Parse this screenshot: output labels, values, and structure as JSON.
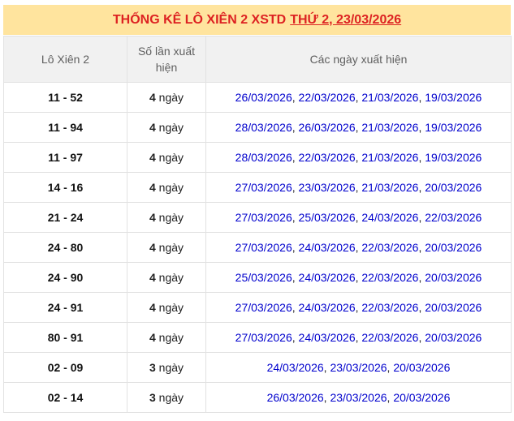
{
  "title": {
    "prefix": "THỐNG KÊ LÔ XIÊN 2 XSTD",
    "link": "THỨ 2, 23/03/2026"
  },
  "table": {
    "headers": [
      "Lô Xiên 2",
      "Số lần xuất hiện",
      "Các ngày xuất hiện"
    ],
    "rows": [
      {
        "pair": "11 - 52",
        "count_num": "4",
        "count_unit": "ngày",
        "dates": [
          "26/03/2026",
          "22/03/2026",
          "21/03/2026",
          "19/03/2026"
        ]
      },
      {
        "pair": "11 - 94",
        "count_num": "4",
        "count_unit": "ngày",
        "dates": [
          "28/03/2026",
          "26/03/2026",
          "21/03/2026",
          "19/03/2026"
        ]
      },
      {
        "pair": "11 - 97",
        "count_num": "4",
        "count_unit": "ngày",
        "dates": [
          "28/03/2026",
          "22/03/2026",
          "21/03/2026",
          "19/03/2026"
        ]
      },
      {
        "pair": "14 - 16",
        "count_num": "4",
        "count_unit": "ngày",
        "dates": [
          "27/03/2026",
          "23/03/2026",
          "21/03/2026",
          "20/03/2026"
        ]
      },
      {
        "pair": "21 - 24",
        "count_num": "4",
        "count_unit": "ngày",
        "dates": [
          "27/03/2026",
          "25/03/2026",
          "24/03/2026",
          "22/03/2026"
        ]
      },
      {
        "pair": "24 - 80",
        "count_num": "4",
        "count_unit": "ngày",
        "dates": [
          "27/03/2026",
          "24/03/2026",
          "22/03/2026",
          "20/03/2026"
        ]
      },
      {
        "pair": "24 - 90",
        "count_num": "4",
        "count_unit": "ngày",
        "dates": [
          "25/03/2026",
          "24/03/2026",
          "22/03/2026",
          "20/03/2026"
        ]
      },
      {
        "pair": "24 - 91",
        "count_num": "4",
        "count_unit": "ngày",
        "dates": [
          "27/03/2026",
          "24/03/2026",
          "22/03/2026",
          "20/03/2026"
        ]
      },
      {
        "pair": "80 - 91",
        "count_num": "4",
        "count_unit": "ngày",
        "dates": [
          "27/03/2026",
          "24/03/2026",
          "22/03/2026",
          "20/03/2026"
        ]
      },
      {
        "pair": "02 - 09",
        "count_num": "3",
        "count_unit": "ngày",
        "dates": [
          "24/03/2026",
          "23/03/2026",
          "20/03/2026"
        ]
      },
      {
        "pair": "02 - 14",
        "count_num": "3",
        "count_unit": "ngày",
        "dates": [
          "26/03/2026",
          "23/03/2026",
          "20/03/2026"
        ]
      }
    ]
  },
  "colors": {
    "title_bg": "#ffe49e",
    "title_text": "#dd2222",
    "header_bg": "#f1f1f1",
    "header_text": "#5f5f5f",
    "border": "#e2e2e2",
    "link": "#0000cd",
    "text": "#222222"
  }
}
